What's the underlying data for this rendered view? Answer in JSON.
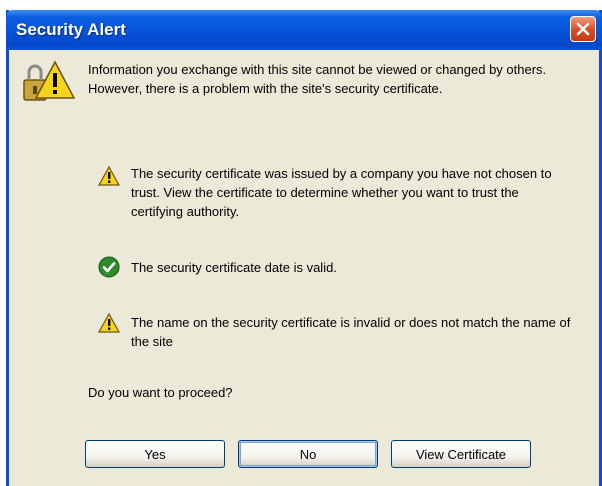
{
  "window": {
    "title": "Security Alert"
  },
  "dialog": {
    "intro": "Information you exchange with this site cannot be viewed or changed by others. However, there is a problem with the site's security certificate.",
    "items": [
      {
        "icon": "warning-icon",
        "text": "The security certificate was issued by a company you have not chosen to trust. View the certificate to determine whether you want to trust the certifying authority."
      },
      {
        "icon": "check-icon",
        "text": "The security certificate date is valid."
      },
      {
        "icon": "warning-icon",
        "text": "The name on the security certificate is invalid or does not match the name of the site"
      }
    ],
    "question": "Do you want to proceed?"
  },
  "buttons": {
    "yes": "Yes",
    "no": "No",
    "view_certificate": "View Certificate"
  },
  "colors": {
    "titlebar": "#0553d9",
    "dialog_bg": "#ece9d8",
    "warning": "#f6d41b",
    "check": "#2e8b2e",
    "close": "#d8502a"
  }
}
